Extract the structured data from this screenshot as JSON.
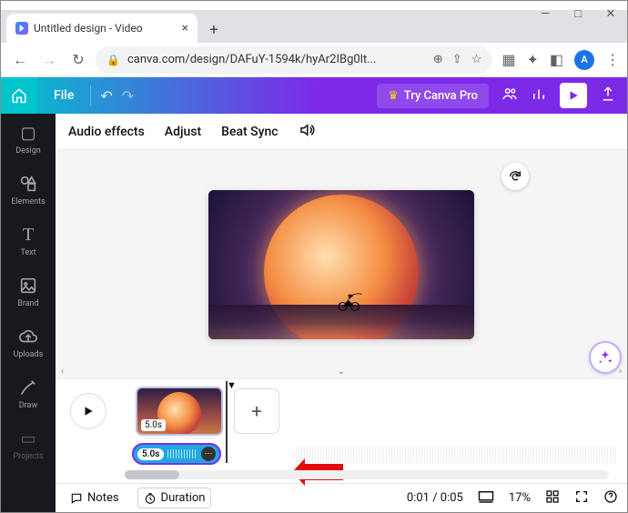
{
  "browser": {
    "tab_title": "Untitled design - Video",
    "url": "canva.com/design/DAFuY-1594k/hyAr2IBg0lt...",
    "avatar_letter": "A"
  },
  "canva_header": {
    "file_label": "File",
    "try_pro": "Try Canva Pro"
  },
  "left_nav": {
    "design": "Design",
    "elements": "Elements",
    "text": "Text",
    "brand": "Brand",
    "uploads": "Uploads",
    "draw": "Draw",
    "projects": "Projects"
  },
  "audio_toolbar": {
    "effects": "Audio effects",
    "adjust": "Adjust",
    "beatsync": "Beat Sync"
  },
  "timeline": {
    "clip_duration": "5.0s",
    "audio_duration": "5.0s"
  },
  "bottom": {
    "notes": "Notes",
    "duration": "Duration",
    "time": "0:01 / 0:05",
    "zoom": "17%"
  }
}
